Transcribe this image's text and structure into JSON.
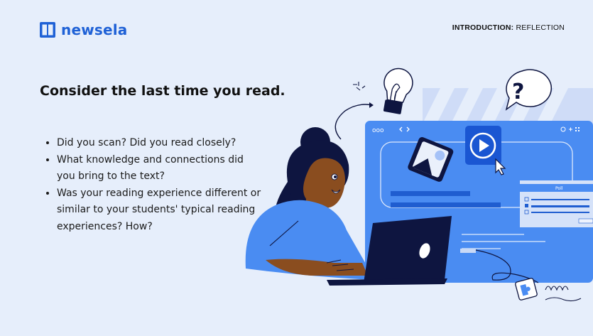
{
  "brand": {
    "name": "newsela",
    "logo_color": "#1f61d6"
  },
  "section": {
    "label_strong": "INTRODUCTION:",
    "label_rest": "REFLECTION"
  },
  "main": {
    "heading": "Consider the last time you read.",
    "questions": [
      "Did you scan? Did you read closely?",
      "What knowledge and connections did you bring to the text?",
      "Was your reading experience different or similar to your students' typical reading experiences? How?"
    ]
  },
  "illustration": {
    "window_dots": "ooo",
    "question_mark": "?",
    "poll_title": "Poll",
    "colors": {
      "window": "#4a8cf2",
      "dark": "#0e1540",
      "skin": "#8a4d1f",
      "shirt": "#4a8cf2",
      "background": "#e6eefb"
    },
    "icons": [
      "lightbulb-icon",
      "question-bubble-icon",
      "play-button-icon",
      "image-icon",
      "cursor-icon",
      "puzzle-icon",
      "laptop-icon"
    ]
  }
}
